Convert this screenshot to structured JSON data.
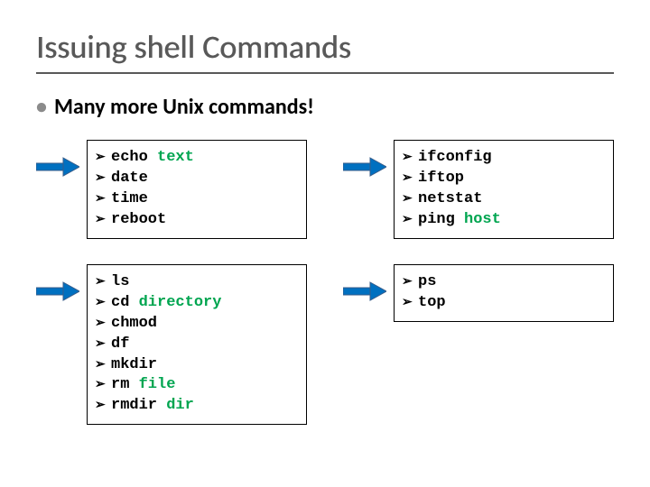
{
  "title": "Issuing shell Commands",
  "subtitle": "Many more Unix commands!",
  "boxes": [
    {
      "items": [
        {
          "cmd": "echo ",
          "arg": "text"
        },
        {
          "cmd": "date"
        },
        {
          "cmd": "time"
        },
        {
          "cmd": "reboot"
        }
      ]
    },
    {
      "items": [
        {
          "cmd": "ifconfig"
        },
        {
          "cmd": "iftop"
        },
        {
          "cmd": "netstat"
        },
        {
          "cmd": "ping ",
          "arg": "host"
        }
      ]
    },
    {
      "items": [
        {
          "cmd": "ls"
        },
        {
          "cmd": "cd ",
          "arg": "directory"
        },
        {
          "cmd": "chmod"
        },
        {
          "cmd": "df"
        },
        {
          "cmd": "mkdir"
        },
        {
          "cmd": "rm ",
          "arg": "file"
        },
        {
          "cmd": "rmdir ",
          "arg": "dir"
        }
      ]
    },
    {
      "items": [
        {
          "cmd": "ps"
        },
        {
          "cmd": "top"
        }
      ]
    }
  ]
}
